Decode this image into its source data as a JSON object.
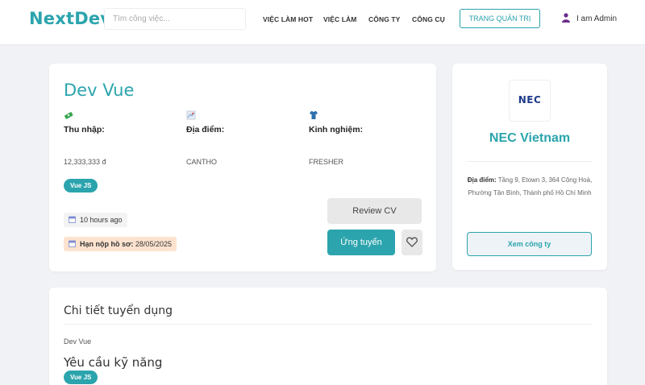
{
  "header": {
    "logo": "NextDev",
    "search_placeholder": "Tìm công việc...",
    "nav": [
      "VIỆC LÀM HOT",
      "VIỆC LÀM",
      "CÔNG TY",
      "CÔNG CỤ"
    ],
    "admin_button": "TRANG QUẢN TRỊ",
    "user_name": "I am Admin"
  },
  "job": {
    "title": "Dev Vue",
    "salary_label": "Thu nhập:",
    "salary_value": "12,333,333 đ",
    "location_label": "Địa điểm:",
    "location_value": "CANTHO",
    "experience_label": "Kinh nghiệm:",
    "experience_value": "FRESHER",
    "tag": "Vue JS",
    "posted": "10 hours ago",
    "deadline_label": "Hạn nộp hồ sơ:",
    "deadline_value": "28/05/2025",
    "review_button": "Review CV",
    "apply_button": "Ứng tuyển"
  },
  "company": {
    "logo_text": "NEC",
    "name": "NEC Vietnam",
    "address_label": "Địa điểm:",
    "address_value": "Tầng 9, Etown 3, 364 Cộng Hoà, Phường Tân Bình, Thành phố Hồ Chí Minh",
    "view_button": "Xem công ty"
  },
  "details": {
    "section_title": "Chi tiết tuyển dụng",
    "subtitle": "Dev Vue",
    "skills_title": "Yêu cầu kỹ năng",
    "skills_tag": "Vue JS"
  },
  "colors": {
    "accent": "#2ba4ad",
    "deadline_bg": "#fde3cf",
    "page_bg": "#f0f2f5"
  }
}
